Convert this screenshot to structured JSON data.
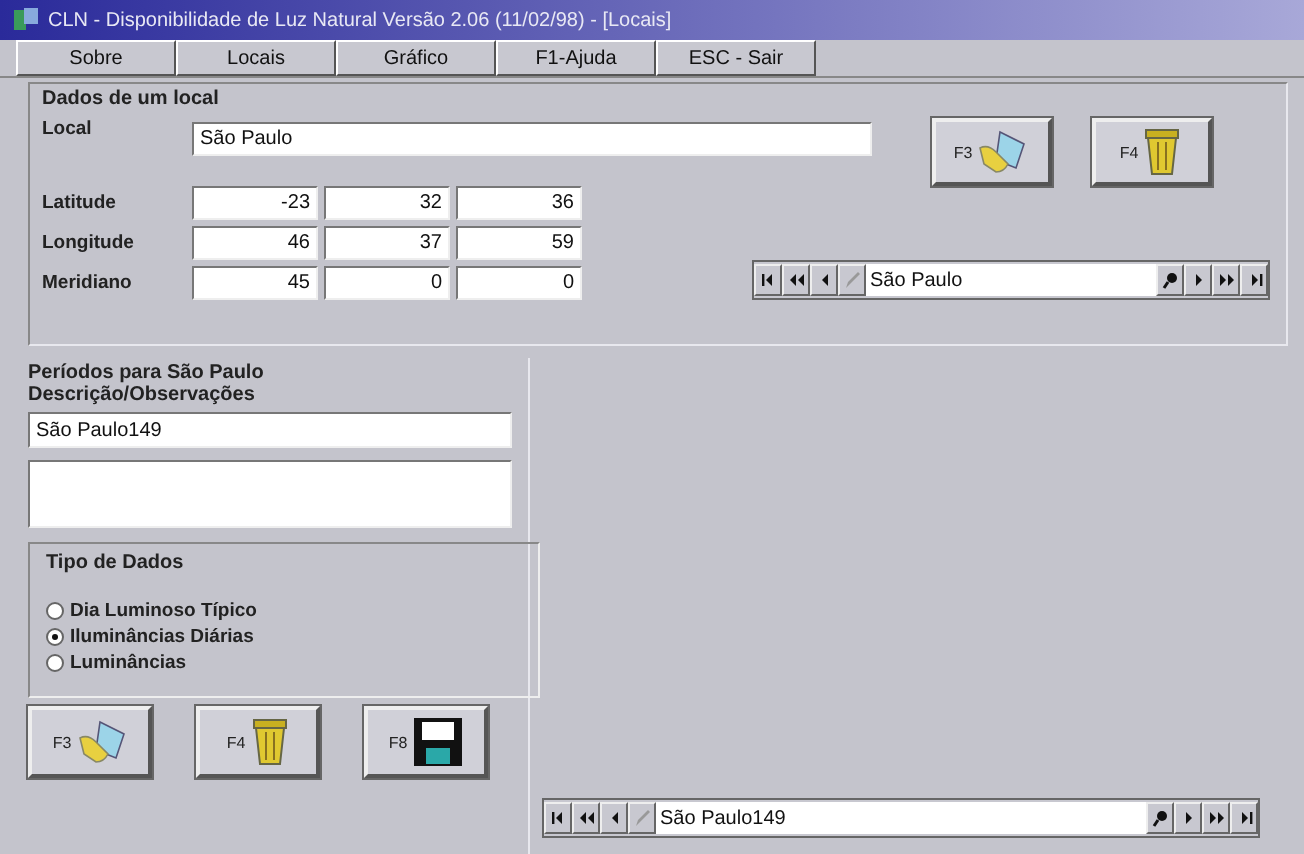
{
  "window": {
    "title": "CLN - Disponibilidade de Luz Natural Versão 2.06 (11/02/98) - [Locais]"
  },
  "menu": [
    {
      "label": "Sobre"
    },
    {
      "label": "Locais"
    },
    {
      "label": "Gráfico"
    },
    {
      "label": "F1-Ajuda"
    },
    {
      "label": "ESC - Sair"
    }
  ],
  "location": {
    "title": "Dados de um local",
    "name_label": "Local",
    "name": "São Paulo",
    "coordinates": [
      {
        "label": "Latitude",
        "values": [
          "-23",
          "32",
          "36"
        ]
      },
      {
        "label": "Longitude",
        "values": [
          "46",
          "37",
          "59"
        ]
      },
      {
        "label": "Meridiano",
        "values": [
          "45",
          "0",
          "0"
        ]
      }
    ],
    "actions": [
      {
        "kind": "new",
        "key": "F3"
      },
      {
        "kind": "delete",
        "key": "F4"
      }
    ],
    "navigator": {
      "value": "São Paulo"
    }
  },
  "periods": {
    "title": "Períodos para São Paulo",
    "description_label": "Descrição/Observações",
    "description": "São Paulo149",
    "data_type": {
      "title": "Tipo de Dados",
      "options": [
        {
          "label": "Dia Luminoso Típico",
          "selected": false
        },
        {
          "label": "Iluminâncias Diárias",
          "selected": true
        },
        {
          "label": "Luminâncias",
          "selected": false
        }
      ]
    },
    "actions": [
      {
        "kind": "new",
        "key": "F3"
      },
      {
        "kind": "delete",
        "key": "F4"
      },
      {
        "kind": "save",
        "key": "F8"
      }
    ],
    "navigator": {
      "value": "São Paulo149"
    }
  }
}
